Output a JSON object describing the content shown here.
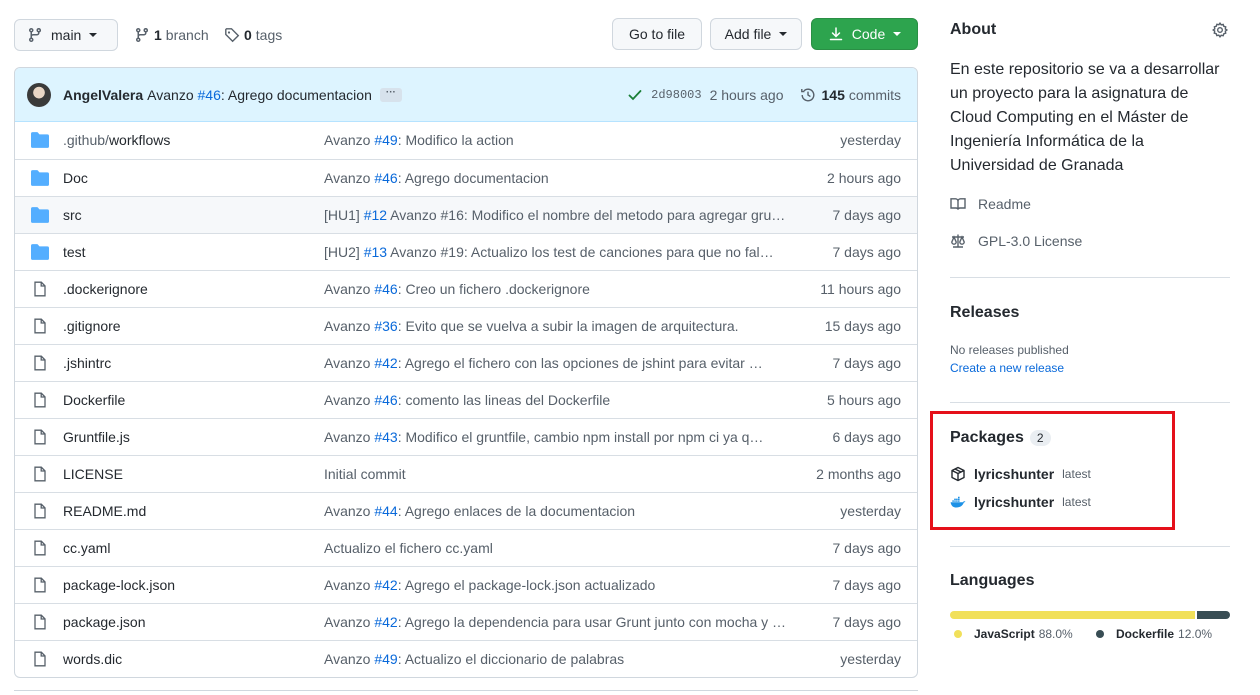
{
  "branch": {
    "name": "main",
    "branch_count": "1",
    "branch_label": "branch",
    "tag_count": "0",
    "tag_label": "tags"
  },
  "toolbar": {
    "goto_label": "Go to file",
    "add_file_label": "Add file",
    "code_label": "Code"
  },
  "latest_commit": {
    "author": "AngelValera",
    "prefix": "Avanzo",
    "issue": "#46",
    "message": ": Agrego documentacion",
    "ellipsis": "···",
    "sha": "2d98003",
    "time": "2 hours ago",
    "commit_count": "145",
    "commit_label": "commits"
  },
  "files": [
    {
      "type": "dir",
      "name_dim": ".github/",
      "name": "workflows",
      "msg_prefix": "Avanzo ",
      "issue": "#49",
      "msg": ": Modifico la action",
      "age": "yesterday"
    },
    {
      "type": "dir",
      "name_dim": "",
      "name": "Doc",
      "msg_prefix": "Avanzo ",
      "issue": "#46",
      "msg": ": Agrego documentacion",
      "age": "2 hours ago"
    },
    {
      "type": "dir",
      "name_dim": "",
      "name": "src",
      "msg_prefix": "[HU1] ",
      "issue": "#12",
      "msg": " Avanzo #16: Modifico el nombre del metodo para agregar gru…",
      "age": "7 days ago"
    },
    {
      "type": "dir",
      "name_dim": "",
      "name": "test",
      "msg_prefix": "[HU2] ",
      "issue": "#13",
      "msg": " Avanzo #19: Actualizo los test de canciones para que no fal…",
      "age": "7 days ago"
    },
    {
      "type": "file",
      "name_dim": "",
      "name": ".dockerignore",
      "msg_prefix": "Avanzo ",
      "issue": "#46",
      "msg": ": Creo un fichero .dockerignore",
      "age": "11 hours ago"
    },
    {
      "type": "file",
      "name_dim": "",
      "name": ".gitignore",
      "msg_prefix": "Avanzo ",
      "issue": "#36",
      "msg": ": Evito que se vuelva a subir la imagen de arquitectura.",
      "age": "15 days ago"
    },
    {
      "type": "file",
      "name_dim": "",
      "name": ".jshintrc",
      "msg_prefix": "Avanzo ",
      "issue": "#42",
      "msg": ": Agrego el fichero con las opciones de jshint para evitar …",
      "age": "7 days ago"
    },
    {
      "type": "file",
      "name_dim": "",
      "name": "Dockerfile",
      "msg_prefix": "Avanzo ",
      "issue": "#46",
      "msg": ": comento las lineas del Dockerfile",
      "age": "5 hours ago"
    },
    {
      "type": "file",
      "name_dim": "",
      "name": "Gruntfile.js",
      "msg_prefix": "Avanzo ",
      "issue": "#43",
      "msg": ": Modifico el gruntfile, cambio npm install por npm ci ya q…",
      "age": "6 days ago"
    },
    {
      "type": "file",
      "name_dim": "",
      "name": "LICENSE",
      "msg_prefix": "Initial commit",
      "issue": "",
      "msg": "",
      "age": "2 months ago"
    },
    {
      "type": "file",
      "name_dim": "",
      "name": "README.md",
      "msg_prefix": "Avanzo ",
      "issue": "#44",
      "msg": ": Agrego enlaces de la documentacion",
      "age": "yesterday"
    },
    {
      "type": "file",
      "name_dim": "",
      "name": "cc.yaml",
      "msg_prefix": "Actualizo el fichero cc.yaml",
      "issue": "",
      "msg": "",
      "age": "7 days ago"
    },
    {
      "type": "file",
      "name_dim": "",
      "name": "package-lock.json",
      "msg_prefix": "Avanzo ",
      "issue": "#42",
      "msg": ": Agrego el package-lock.json actualizado",
      "age": "7 days ago"
    },
    {
      "type": "file",
      "name_dim": "",
      "name": "package.json",
      "msg_prefix": "Avanzo ",
      "issue": "#42",
      "msg": ": Agrego la dependencia para usar Grunt junto con mocha y …",
      "age": "7 days ago"
    },
    {
      "type": "file",
      "name_dim": "",
      "name": "words.dic",
      "msg_prefix": "Avanzo ",
      "issue": "#49",
      "msg": ": Actualizo el diccionario de palabras",
      "age": "yesterday"
    }
  ],
  "about": {
    "heading": "About",
    "description": "En este repositorio se va a desarrollar un proyecto para la asignatura de Cloud Computing en el Máster de Ingeniería Informática de la Universidad de Granada",
    "readme_label": "Readme",
    "license_label": "GPL-3.0 License"
  },
  "releases": {
    "heading": "Releases",
    "none_text": "No releases published",
    "create_link": "Create a new release"
  },
  "packages": {
    "heading": "Packages",
    "count": "2",
    "items": [
      {
        "name": "lyricshunter",
        "tag": "latest",
        "icon": "package-icon"
      },
      {
        "name": "lyricshunter",
        "tag": "latest",
        "icon": "docker-icon"
      }
    ]
  },
  "languages": {
    "heading": "Languages",
    "items": [
      {
        "name": "JavaScript",
        "percent": "88.0%",
        "value": 88.0,
        "color": "#f1e05a"
      },
      {
        "name": "Dockerfile",
        "percent": "12.0%",
        "value": 12.0,
        "color": "#384d54"
      }
    ]
  },
  "colors": {
    "accent": "#0969da",
    "code_button": "#2da44e",
    "highlight_box": "#e5101a",
    "folder": "#54aeff"
  }
}
